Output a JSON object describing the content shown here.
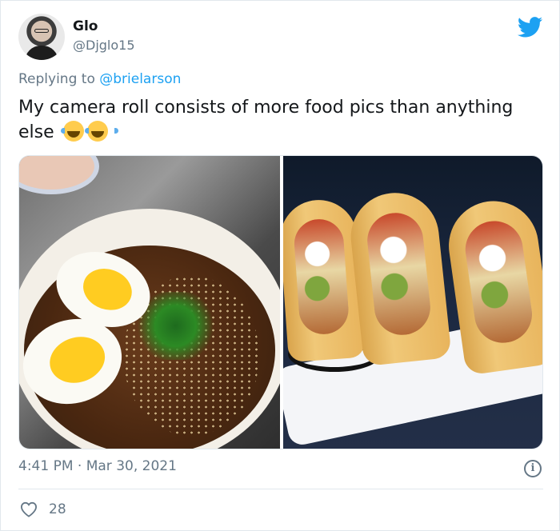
{
  "author": {
    "name": "Glo",
    "handle": "@Djglo15"
  },
  "reply": {
    "prefix": "Replying to",
    "to": "@brielarson"
  },
  "tweet": {
    "text": "My camera roll consists of more food pics than anything else",
    "emojis": [
      "face-with-tears-of-joy",
      "face-with-tears-of-joy"
    ],
    "timestamp": "4:41 PM · Mar 30, 2021",
    "likes": "28"
  },
  "media": [
    {
      "subject": "ramen bowl with boiled eggs"
    },
    {
      "subject": "three tacos on a tray"
    }
  ],
  "colors": {
    "brand": "#1da1f2",
    "muted": "#657786",
    "text": "#14171a",
    "border": "#e1e8ed"
  },
  "icons": [
    "twitter-bird-icon",
    "info-icon",
    "heart-icon"
  ]
}
